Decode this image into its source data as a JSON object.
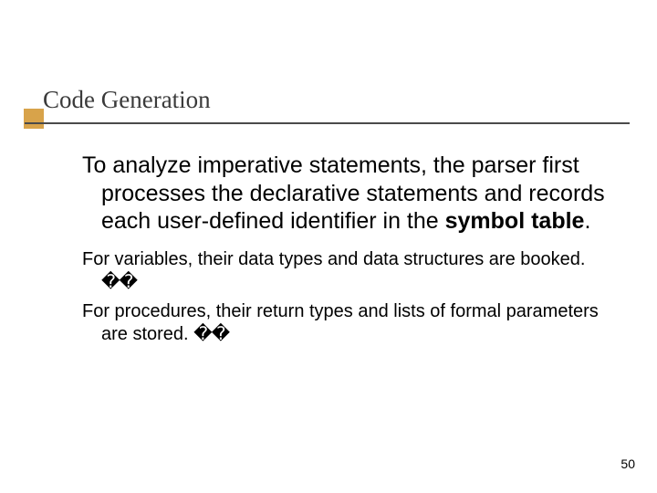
{
  "title": "Code Generation",
  "body": {
    "main_text_prefix": "To analyze imperative statements, the parser first processes the declarative statements and records each user-defined identifier in the ",
    "main_text_bold": "symbol table",
    "main_text_suffix": ".",
    "sub1_text": "For variables, their data types and data structures are booked. ",
    "sub1_glyphs": "��",
    "sub2_text": "For procedures, their return types and lists of formal parameters are stored. ",
    "sub2_glyphs": "��"
  },
  "page_number": "50"
}
